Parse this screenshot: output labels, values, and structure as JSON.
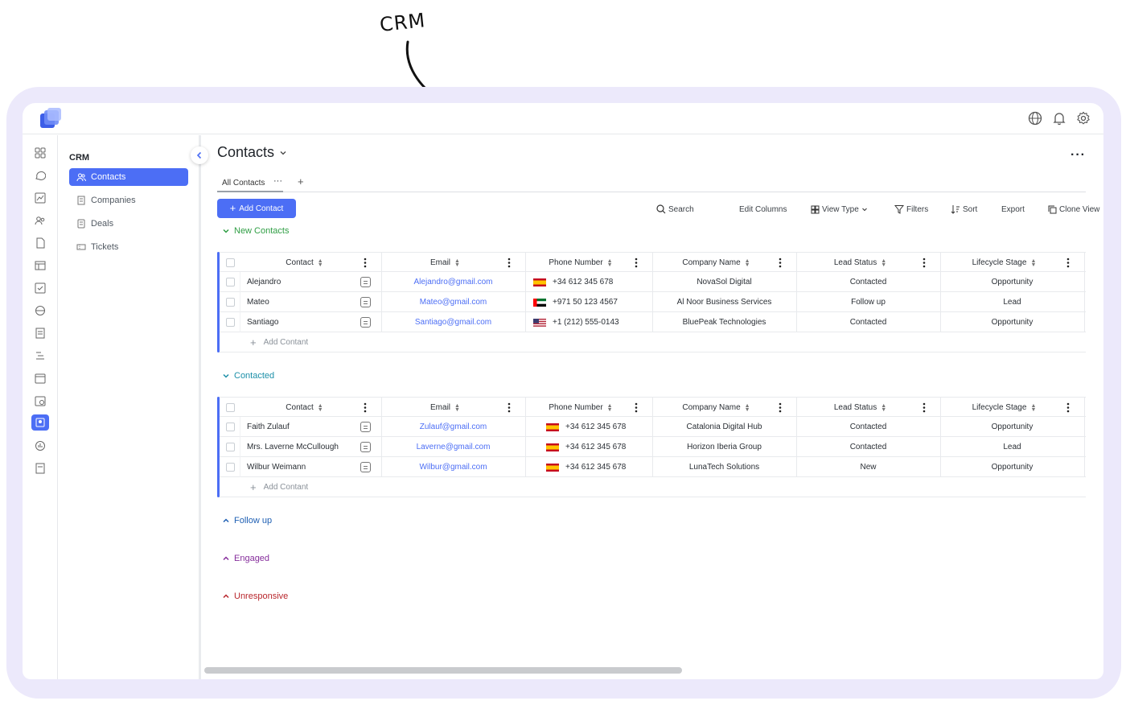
{
  "annotation": {
    "label": "CRM"
  },
  "colors": {
    "accent": "#4c6ef5",
    "new_contacts": "#2f9e44",
    "contacted": "#1c8fa8",
    "follow_up": "#1e5fb3",
    "engaged": "#862e9c",
    "unresponsive": "#b8262c"
  },
  "topbar": {
    "icons": [
      "globe-icon",
      "bell-icon",
      "gear-icon"
    ]
  },
  "sidebar": {
    "title": "CRM",
    "items": [
      {
        "label": "Contacts",
        "icon": "users-icon",
        "active": true
      },
      {
        "label": "Companies",
        "icon": "building-icon",
        "active": false
      },
      {
        "label": "Deals",
        "icon": "document-icon",
        "active": false
      },
      {
        "label": "Tickets",
        "icon": "ticket-icon",
        "active": false
      }
    ]
  },
  "page": {
    "title": "Contacts"
  },
  "tabs": {
    "active": "All Contacts",
    "more": "···",
    "add": "+"
  },
  "toolbar": {
    "add_contact": "Add Contact",
    "search": "Search",
    "edit_columns": "Edit Columns",
    "view_type": "View Type",
    "filters": "Filters",
    "sort": "Sort",
    "export": "Export",
    "clone_view": "Clone View"
  },
  "columns": [
    "Contact",
    "Email",
    "Phone Number",
    "Company Name",
    "Lead Status",
    "Lifecycle Stage"
  ],
  "add_row_label": "Add Contant",
  "groups": [
    {
      "name": "New Contacts",
      "color": "#2f9e44",
      "expanded": true,
      "rows": [
        {
          "contact": "Alejandro",
          "email": "Alejandro@gmail.com",
          "flag": "es",
          "phone": "+34 612 345 678",
          "company": "NovaSol Digital",
          "lead_status": "Contacted",
          "lifecycle": "Opportunity"
        },
        {
          "contact": "Mateo",
          "email": "Mateo@gmail.com",
          "flag": "ae",
          "phone": "+971 50 123 4567",
          "company": "Al Noor Business Services",
          "lead_status": "Follow up",
          "lifecycle": "Lead"
        },
        {
          "contact": "Santiago",
          "email": "Santiago@gmail.com",
          "flag": "us",
          "phone": "+1 (212) 555-0143",
          "company": "BluePeak Technologies",
          "lead_status": "Contacted",
          "lifecycle": "Opportunity"
        }
      ]
    },
    {
      "name": "Contacted",
      "color": "#1c8fa8",
      "expanded": true,
      "rows": [
        {
          "contact": "Faith Zulauf",
          "email": "Zulauf@gmail.com",
          "flag": "es",
          "phone": "+34 612 345 678",
          "company": "Catalonia Digital Hub",
          "lead_status": "Contacted",
          "lifecycle": "Opportunity"
        },
        {
          "contact": "Mrs. Laverne McCullough",
          "email": "Laverne@gmail.com",
          "flag": "es",
          "phone": "+34 612 345 678",
          "company": "Horizon Iberia Group",
          "lead_status": "Contacted",
          "lifecycle": "Lead"
        },
        {
          "contact": "Wilbur Weimann",
          "email": "Wilbur@gmail.com",
          "flag": "es",
          "phone": "+34 612 345 678",
          "company": "LunaTech Solutions",
          "lead_status": "New",
          "lifecycle": "Opportunity"
        }
      ]
    },
    {
      "name": "Follow up",
      "color": "#1e5fb3",
      "expanded": false
    },
    {
      "name": "Engaged",
      "color": "#862e9c",
      "expanded": false
    },
    {
      "name": "Unresponsive",
      "color": "#b8262c",
      "expanded": false
    }
  ]
}
